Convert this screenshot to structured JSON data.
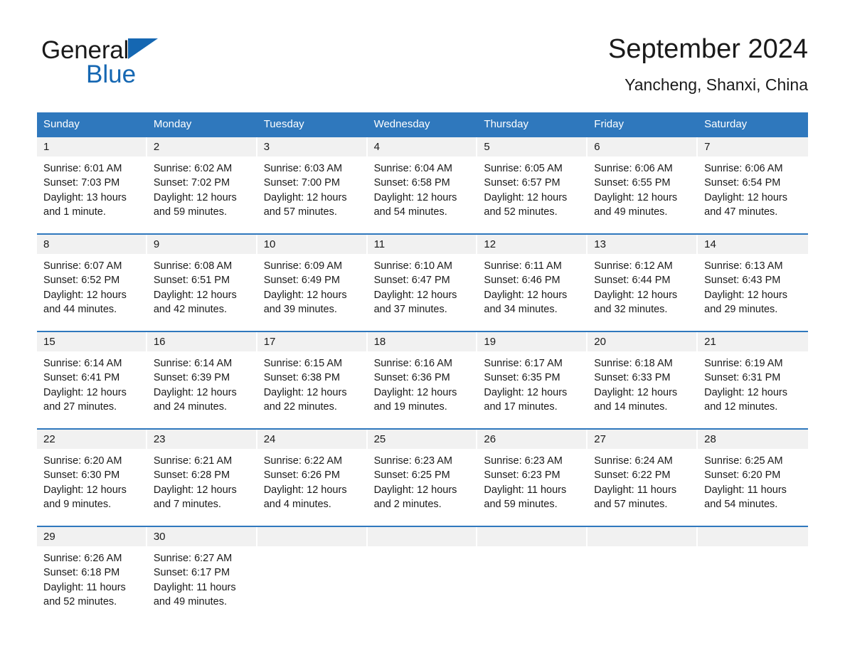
{
  "brand": {
    "name_part1": "General",
    "name_part2": "Blue",
    "triangle_color": "#1567b2",
    "accent_color": "#2f78bd"
  },
  "header": {
    "title": "September 2024",
    "subtitle": "Yancheng, Shanxi, China"
  },
  "calendar": {
    "weekdays": [
      "Sunday",
      "Monday",
      "Tuesday",
      "Wednesday",
      "Thursday",
      "Friday",
      "Saturday"
    ],
    "weeks": [
      {
        "days": [
          {
            "num": "1",
            "sunrise": "Sunrise: 6:01 AM",
            "sunset": "Sunset: 7:03 PM",
            "daylight1": "Daylight: 13 hours",
            "daylight2": "and 1 minute."
          },
          {
            "num": "2",
            "sunrise": "Sunrise: 6:02 AM",
            "sunset": "Sunset: 7:02 PM",
            "daylight1": "Daylight: 12 hours",
            "daylight2": "and 59 minutes."
          },
          {
            "num": "3",
            "sunrise": "Sunrise: 6:03 AM",
            "sunset": "Sunset: 7:00 PM",
            "daylight1": "Daylight: 12 hours",
            "daylight2": "and 57 minutes."
          },
          {
            "num": "4",
            "sunrise": "Sunrise: 6:04 AM",
            "sunset": "Sunset: 6:58 PM",
            "daylight1": "Daylight: 12 hours",
            "daylight2": "and 54 minutes."
          },
          {
            "num": "5",
            "sunrise": "Sunrise: 6:05 AM",
            "sunset": "Sunset: 6:57 PM",
            "daylight1": "Daylight: 12 hours",
            "daylight2": "and 52 minutes."
          },
          {
            "num": "6",
            "sunrise": "Sunrise: 6:06 AM",
            "sunset": "Sunset: 6:55 PM",
            "daylight1": "Daylight: 12 hours",
            "daylight2": "and 49 minutes."
          },
          {
            "num": "7",
            "sunrise": "Sunrise: 6:06 AM",
            "sunset": "Sunset: 6:54 PM",
            "daylight1": "Daylight: 12 hours",
            "daylight2": "and 47 minutes."
          }
        ]
      },
      {
        "days": [
          {
            "num": "8",
            "sunrise": "Sunrise: 6:07 AM",
            "sunset": "Sunset: 6:52 PM",
            "daylight1": "Daylight: 12 hours",
            "daylight2": "and 44 minutes."
          },
          {
            "num": "9",
            "sunrise": "Sunrise: 6:08 AM",
            "sunset": "Sunset: 6:51 PM",
            "daylight1": "Daylight: 12 hours",
            "daylight2": "and 42 minutes."
          },
          {
            "num": "10",
            "sunrise": "Sunrise: 6:09 AM",
            "sunset": "Sunset: 6:49 PM",
            "daylight1": "Daylight: 12 hours",
            "daylight2": "and 39 minutes."
          },
          {
            "num": "11",
            "sunrise": "Sunrise: 6:10 AM",
            "sunset": "Sunset: 6:47 PM",
            "daylight1": "Daylight: 12 hours",
            "daylight2": "and 37 minutes."
          },
          {
            "num": "12",
            "sunrise": "Sunrise: 6:11 AM",
            "sunset": "Sunset: 6:46 PM",
            "daylight1": "Daylight: 12 hours",
            "daylight2": "and 34 minutes."
          },
          {
            "num": "13",
            "sunrise": "Sunrise: 6:12 AM",
            "sunset": "Sunset: 6:44 PM",
            "daylight1": "Daylight: 12 hours",
            "daylight2": "and 32 minutes."
          },
          {
            "num": "14",
            "sunrise": "Sunrise: 6:13 AM",
            "sunset": "Sunset: 6:43 PM",
            "daylight1": "Daylight: 12 hours",
            "daylight2": "and 29 minutes."
          }
        ]
      },
      {
        "days": [
          {
            "num": "15",
            "sunrise": "Sunrise: 6:14 AM",
            "sunset": "Sunset: 6:41 PM",
            "daylight1": "Daylight: 12 hours",
            "daylight2": "and 27 minutes."
          },
          {
            "num": "16",
            "sunrise": "Sunrise: 6:14 AM",
            "sunset": "Sunset: 6:39 PM",
            "daylight1": "Daylight: 12 hours",
            "daylight2": "and 24 minutes."
          },
          {
            "num": "17",
            "sunrise": "Sunrise: 6:15 AM",
            "sunset": "Sunset: 6:38 PM",
            "daylight1": "Daylight: 12 hours",
            "daylight2": "and 22 minutes."
          },
          {
            "num": "18",
            "sunrise": "Sunrise: 6:16 AM",
            "sunset": "Sunset: 6:36 PM",
            "daylight1": "Daylight: 12 hours",
            "daylight2": "and 19 minutes."
          },
          {
            "num": "19",
            "sunrise": "Sunrise: 6:17 AM",
            "sunset": "Sunset: 6:35 PM",
            "daylight1": "Daylight: 12 hours",
            "daylight2": "and 17 minutes."
          },
          {
            "num": "20",
            "sunrise": "Sunrise: 6:18 AM",
            "sunset": "Sunset: 6:33 PM",
            "daylight1": "Daylight: 12 hours",
            "daylight2": "and 14 minutes."
          },
          {
            "num": "21",
            "sunrise": "Sunrise: 6:19 AM",
            "sunset": "Sunset: 6:31 PM",
            "daylight1": "Daylight: 12 hours",
            "daylight2": "and 12 minutes."
          }
        ]
      },
      {
        "days": [
          {
            "num": "22",
            "sunrise": "Sunrise: 6:20 AM",
            "sunset": "Sunset: 6:30 PM",
            "daylight1": "Daylight: 12 hours",
            "daylight2": "and 9 minutes."
          },
          {
            "num": "23",
            "sunrise": "Sunrise: 6:21 AM",
            "sunset": "Sunset: 6:28 PM",
            "daylight1": "Daylight: 12 hours",
            "daylight2": "and 7 minutes."
          },
          {
            "num": "24",
            "sunrise": "Sunrise: 6:22 AM",
            "sunset": "Sunset: 6:26 PM",
            "daylight1": "Daylight: 12 hours",
            "daylight2": "and 4 minutes."
          },
          {
            "num": "25",
            "sunrise": "Sunrise: 6:23 AM",
            "sunset": "Sunset: 6:25 PM",
            "daylight1": "Daylight: 12 hours",
            "daylight2": "and 2 minutes."
          },
          {
            "num": "26",
            "sunrise": "Sunrise: 6:23 AM",
            "sunset": "Sunset: 6:23 PM",
            "daylight1": "Daylight: 11 hours",
            "daylight2": "and 59 minutes."
          },
          {
            "num": "27",
            "sunrise": "Sunrise: 6:24 AM",
            "sunset": "Sunset: 6:22 PM",
            "daylight1": "Daylight: 11 hours",
            "daylight2": "and 57 minutes."
          },
          {
            "num": "28",
            "sunrise": "Sunrise: 6:25 AM",
            "sunset": "Sunset: 6:20 PM",
            "daylight1": "Daylight: 11 hours",
            "daylight2": "and 54 minutes."
          }
        ]
      },
      {
        "days": [
          {
            "num": "29",
            "sunrise": "Sunrise: 6:26 AM",
            "sunset": "Sunset: 6:18 PM",
            "daylight1": "Daylight: 11 hours",
            "daylight2": "and 52 minutes."
          },
          {
            "num": "30",
            "sunrise": "Sunrise: 6:27 AM",
            "sunset": "Sunset: 6:17 PM",
            "daylight1": "Daylight: 11 hours",
            "daylight2": "and 49 minutes."
          },
          {
            "num": "",
            "sunrise": "",
            "sunset": "",
            "daylight1": "",
            "daylight2": ""
          },
          {
            "num": "",
            "sunrise": "",
            "sunset": "",
            "daylight1": "",
            "daylight2": ""
          },
          {
            "num": "",
            "sunrise": "",
            "sunset": "",
            "daylight1": "",
            "daylight2": ""
          },
          {
            "num": "",
            "sunrise": "",
            "sunset": "",
            "daylight1": "",
            "daylight2": ""
          },
          {
            "num": "",
            "sunrise": "",
            "sunset": "",
            "daylight1": "",
            "daylight2": ""
          }
        ]
      }
    ]
  }
}
